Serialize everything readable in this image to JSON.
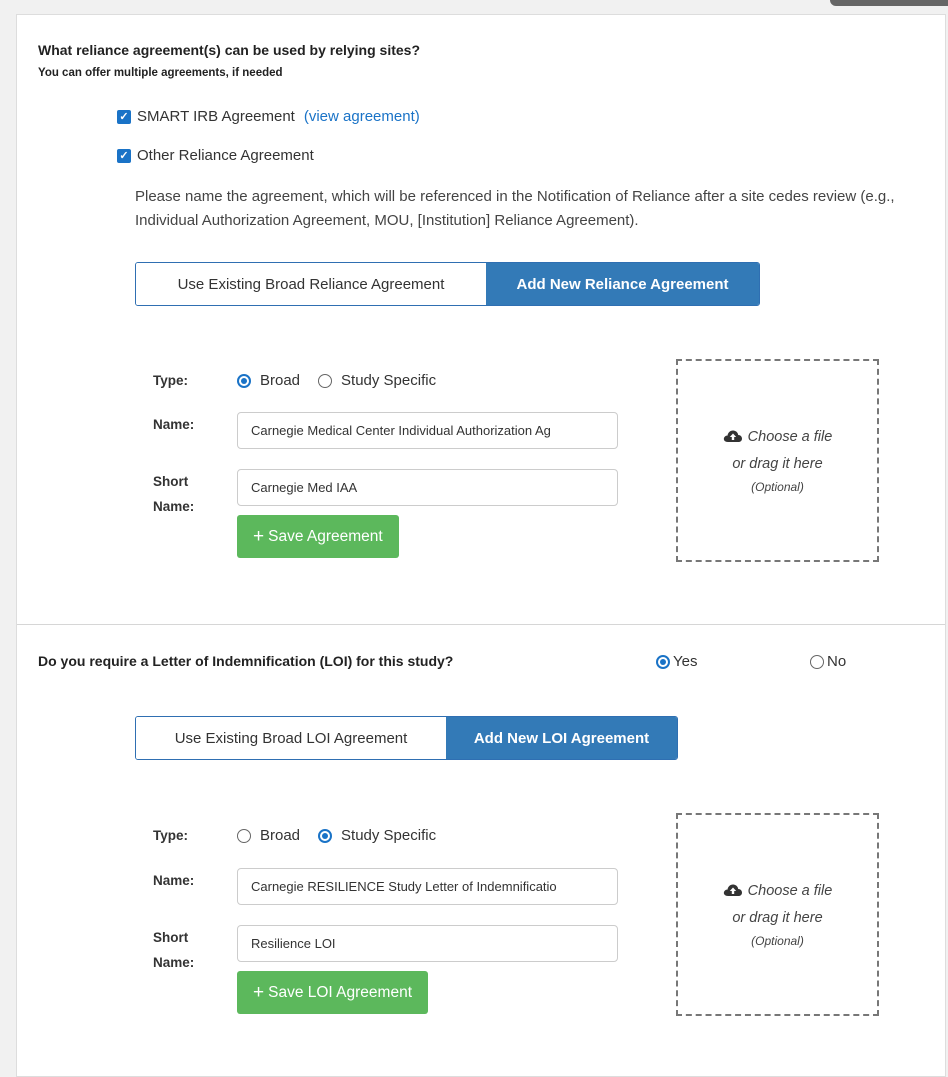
{
  "reliance": {
    "question": "What reliance agreement(s) can be used by relying sites?",
    "subtext": "You can offer multiple agreements, if needed",
    "smart_irb_label": "SMART IRB Agreement",
    "view_agreement_link": "(view agreement)",
    "other_label": "Other Reliance Agreement",
    "help_text": "Please name the agreement, which will be referenced in the Notification of Reliance after a site cedes review (e.g., Individual Authorization Agreement, MOU, [Institution] Reliance Agreement).",
    "toggle_existing": "Use Existing Broad Reliance Agreement",
    "toggle_new": "Add New Reliance Agreement",
    "form": {
      "type_label": "Type:",
      "type_options": [
        "Broad",
        "Study Specific"
      ],
      "type_selected": "Broad",
      "name_label": "Name:",
      "name_value": "Carnegie Medical Center Individual Authorization Ag",
      "short_name_label_1": "Short",
      "short_name_label_2": "Name:",
      "short_name_value": "Carnegie Med IAA",
      "save_label": "Save Agreement"
    },
    "dropzone": {
      "line1": "Choose a file",
      "line2": "or drag it here",
      "optional": "(Optional)"
    }
  },
  "loi": {
    "question": "Do you require a Letter of Indemnification (LOI) for this study?",
    "yes_label": "Yes",
    "no_label": "No",
    "selected": "Yes",
    "toggle_existing": "Use Existing Broad LOI Agreement",
    "toggle_new": "Add New LOI Agreement",
    "form": {
      "type_label": "Type:",
      "type_options": [
        "Broad",
        "Study Specific"
      ],
      "type_selected": "Study Specific",
      "name_label": "Name:",
      "name_value": "Carnegie RESILIENCE Study Letter of Indemnificatio",
      "short_name_label_1": "Short",
      "short_name_label_2": "Name:",
      "short_name_value": "Resilience LOI",
      "save_label": "Save LOI Agreement"
    },
    "dropzone": {
      "line1": "Choose a file",
      "line2": "or drag it here",
      "optional": "(Optional)"
    }
  },
  "colors": {
    "primary": "#337ab7",
    "link": "#1a73c7",
    "success": "#5cb85c"
  }
}
